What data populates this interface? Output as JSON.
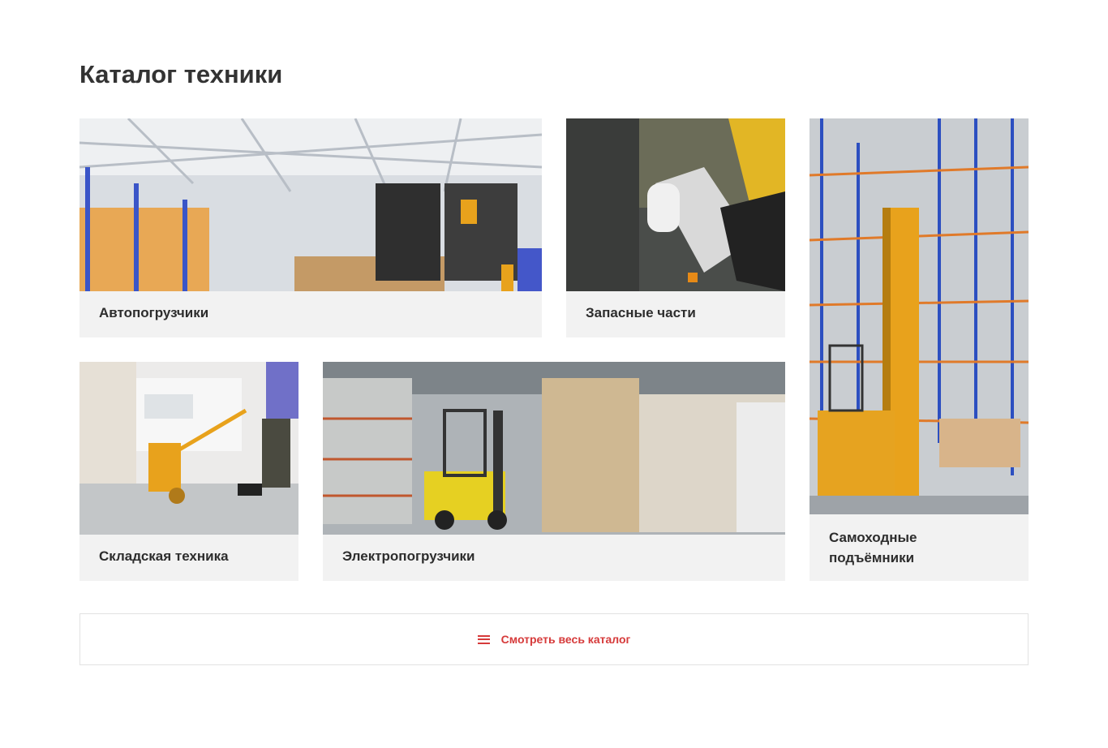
{
  "page": {
    "title": "Каталог техники"
  },
  "categories": [
    {
      "label": "Автопогрузчики"
    },
    {
      "label": "Запасные части"
    },
    {
      "label": "Складская техника"
    },
    {
      "label": "Электропогрузчики"
    },
    {
      "label": "Самоходные подъёмники"
    }
  ],
  "catalog_button": {
    "label": "Смотреть весь каталог",
    "icon": "menu-icon"
  },
  "colors": {
    "accent": "#d63a3a",
    "card_background": "#f2f2f2"
  }
}
